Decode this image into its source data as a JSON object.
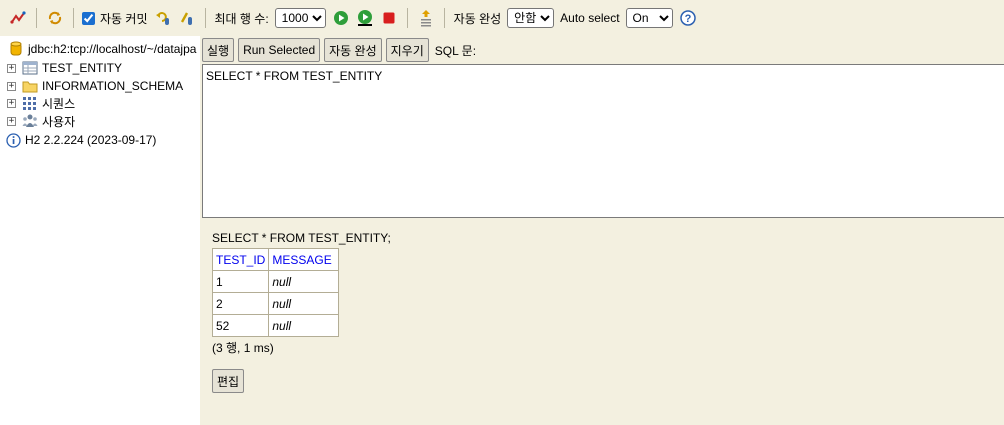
{
  "toolbar": {
    "autocommit_label": "자동 커밋",
    "autocommit_checked": true,
    "maxrows_label": "최대 행 수:",
    "maxrows_value": "1000",
    "autocomplete_label": "자동 완성",
    "autocomplete_value": "안함",
    "autoselect_label": "Auto select",
    "autoselect_value": "On",
    "help_glyph": "?",
    "icons": [
      "disconnect-icon",
      "refresh-icon",
      "rollback-icon",
      "commit-icon",
      "run-icon",
      "run-selected-icon",
      "stop-icon",
      "history-icon",
      "help-icon"
    ]
  },
  "tree": {
    "connection": "jdbc:h2:tcp://localhost/~/datajpa",
    "items": [
      {
        "label": "TEST_ENTITY",
        "icon": "table-icon"
      },
      {
        "label": "INFORMATION_SCHEMA",
        "icon": "folder-icon"
      },
      {
        "label": "시퀀스",
        "icon": "sequence-icon"
      },
      {
        "label": "사용자",
        "icon": "users-icon"
      }
    ],
    "version": "H2 2.2.224 (2023-09-17)"
  },
  "query": {
    "run_label": "실행",
    "run_selected_label": "Run Selected",
    "autocomplete_label": "자동 완성",
    "clear_label": "지우기",
    "sql_label": "SQL 문:",
    "sql_text": "SELECT * FROM TEST_ENTITY"
  },
  "results": {
    "statement": "SELECT * FROM TEST_ENTITY;",
    "columns": [
      "TEST_ID",
      "MESSAGE"
    ],
    "rows": [
      [
        "1",
        "null"
      ],
      [
        "2",
        "null"
      ],
      [
        "52",
        "null"
      ]
    ],
    "summary": "(3 행, 1 ms)",
    "edit_label": "편집"
  },
  "colors": {
    "panel_bg": "#f3f0e0",
    "header_link": "#0000ee",
    "run_green": "#2e9e3a",
    "stop_red": "#d81e1e"
  }
}
